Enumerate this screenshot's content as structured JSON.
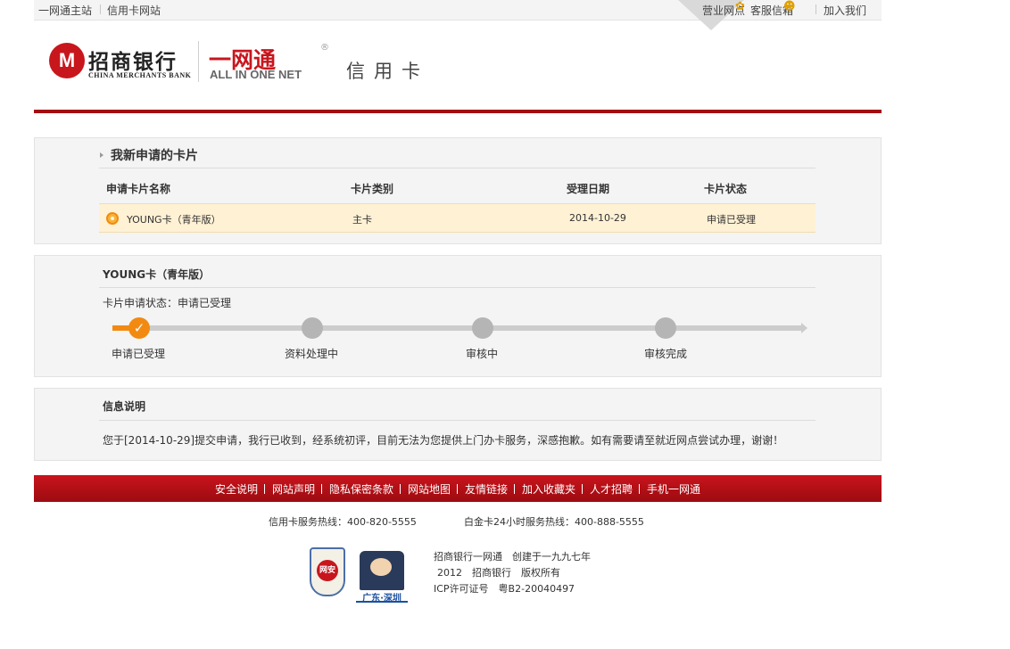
{
  "topbar": {
    "left_links": [
      "一网通主站",
      "信用卡网站"
    ],
    "right_links": [
      "营业网点",
      "客服信箱",
      "加入我们"
    ]
  },
  "header": {
    "bank_cn": "招商银行",
    "bank_en": "CHINA MERCHANTS BANK",
    "ywt_cn": "一网通",
    "ywt_reg": "®",
    "ywt_en": "ALL IN ONE NET",
    "section": "信用卡"
  },
  "applications": {
    "title": "我新申请的卡片",
    "columns": [
      "申请卡片名称",
      "卡片类别",
      "受理日期",
      "卡片状态"
    ],
    "rows": [
      {
        "name": "YOUNG卡（青年版）",
        "category": "主卡",
        "date": "2014-10-29",
        "status": "申请已受理"
      }
    ]
  },
  "progress": {
    "card_title": "YOUNG卡（青年版）",
    "status_label": "卡片申请状态：",
    "status_value": "申请已受理",
    "steps": [
      "申请已受理",
      "资料处理中",
      "审核中",
      "审核完成"
    ],
    "completed_steps": 1,
    "accent_color": "#f28a12"
  },
  "info": {
    "title": "信息说明",
    "text": "您于[2014-10-29]提交申请，我行已收到，经系统初评，目前无法为您提供上门办卡服务，深感抱歉。如有需要请至就近网点尝试办理，谢谢！"
  },
  "footer": {
    "links": [
      "安全说明",
      "网站声明",
      "隐私保密条款",
      "网站地图",
      "友情链接",
      "加入收藏夹",
      "人才招聘",
      "手机一网通"
    ],
    "hotline_credit": "信用卡服务热线：400-820-5555",
    "hotline_platinum": "白金卡24小时服务热线：400-888-5555",
    "badge1_text": "网安",
    "badge2_text": "广东·深圳",
    "copyright_1": "招商银行一网通　创建于一九九七年",
    "copyright_2": "2012　招商银行　版权所有",
    "copyright_3": "ICP许可证号　粤B2-20040497"
  },
  "colors": {
    "brand_red": "#c8161d",
    "header_line": "#a30c12",
    "highlight_row": "#fff1d4"
  }
}
